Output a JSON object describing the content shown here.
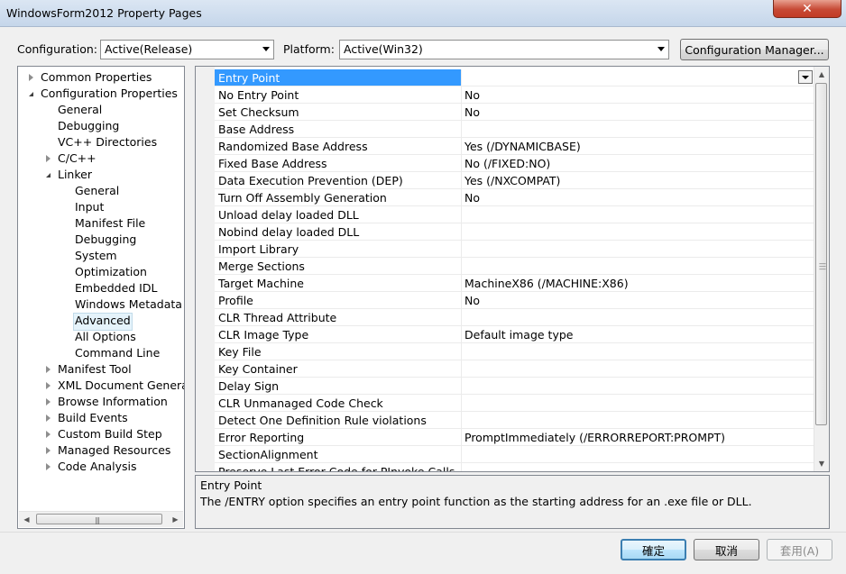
{
  "window": {
    "title": "WindowsForm2012 Property Pages",
    "close_label": "✕"
  },
  "toolbar": {
    "configuration_label": "Configuration:",
    "configuration_value": "Active(Release)",
    "platform_label": "Platform:",
    "platform_value": "Active(Win32)",
    "config_manager_label": "Configuration Manager..."
  },
  "tree": {
    "items": [
      {
        "label": "Common Properties",
        "twisty": "closed"
      },
      {
        "label": "Configuration Properties",
        "twisty": "open"
      },
      {
        "label": "General"
      },
      {
        "label": "Debugging"
      },
      {
        "label": "VC++ Directories"
      },
      {
        "label": "C/C++",
        "twisty": "closed"
      },
      {
        "label": "Linker",
        "twisty": "open"
      },
      {
        "label": "General"
      },
      {
        "label": "Input"
      },
      {
        "label": "Manifest File"
      },
      {
        "label": "Debugging"
      },
      {
        "label": "System"
      },
      {
        "label": "Optimization"
      },
      {
        "label": "Embedded IDL"
      },
      {
        "label": "Windows Metadata"
      },
      {
        "label": "Advanced",
        "selected": true
      },
      {
        "label": "All Options"
      },
      {
        "label": "Command Line"
      },
      {
        "label": "Manifest Tool",
        "twisty": "closed"
      },
      {
        "label": "XML Document Generator",
        "twisty": "closed"
      },
      {
        "label": "Browse Information",
        "twisty": "closed"
      },
      {
        "label": "Build Events",
        "twisty": "closed"
      },
      {
        "label": "Custom Build Step",
        "twisty": "closed"
      },
      {
        "label": "Managed Resources",
        "twisty": "closed"
      },
      {
        "label": "Code Analysis",
        "twisty": "closed"
      }
    ]
  },
  "grid": {
    "rows": [
      {
        "name": "Entry Point",
        "value": "",
        "selected": true
      },
      {
        "name": "No Entry Point",
        "value": "No"
      },
      {
        "name": "Set Checksum",
        "value": "No"
      },
      {
        "name": "Base Address",
        "value": ""
      },
      {
        "name": "Randomized Base Address",
        "value": "Yes (/DYNAMICBASE)"
      },
      {
        "name": "Fixed Base Address",
        "value": "No (/FIXED:NO)"
      },
      {
        "name": "Data Execution Prevention (DEP)",
        "value": "Yes (/NXCOMPAT)"
      },
      {
        "name": "Turn Off Assembly Generation",
        "value": "No"
      },
      {
        "name": "Unload delay loaded DLL",
        "value": ""
      },
      {
        "name": "Nobind delay loaded DLL",
        "value": ""
      },
      {
        "name": "Import Library",
        "value": ""
      },
      {
        "name": "Merge Sections",
        "value": ""
      },
      {
        "name": "Target Machine",
        "value": "MachineX86 (/MACHINE:X86)"
      },
      {
        "name": "Profile",
        "value": "No"
      },
      {
        "name": "CLR Thread Attribute",
        "value": ""
      },
      {
        "name": "CLR Image Type",
        "value": "Default image type"
      },
      {
        "name": "Key File",
        "value": ""
      },
      {
        "name": "Key Container",
        "value": ""
      },
      {
        "name": "Delay Sign",
        "value": ""
      },
      {
        "name": "CLR Unmanaged Code Check",
        "value": ""
      },
      {
        "name": "Detect One Definition Rule violations",
        "value": ""
      },
      {
        "name": "Error Reporting",
        "value": "PromptImmediately (/ERRORREPORT:PROMPT)"
      },
      {
        "name": "SectionAlignment",
        "value": ""
      },
      {
        "name": "Preserve Last Error Code for PInvoke Calls",
        "value": ""
      }
    ]
  },
  "description": {
    "title": "Entry Point",
    "text": "The /ENTRY option specifies an entry point function as the starting address for an .exe file or DLL."
  },
  "buttons": {
    "ok": "確定",
    "cancel": "取消",
    "apply": "套用(A)"
  },
  "colors": {
    "selection": "#3399ff",
    "close": "#c74a35"
  }
}
